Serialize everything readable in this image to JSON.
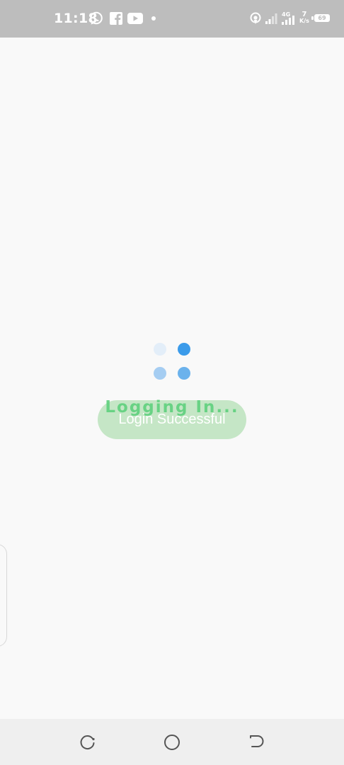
{
  "status_bar": {
    "time": "11:18",
    "notification_icons": [
      "whatsapp-icon",
      "facebook-icon",
      "youtube-icon",
      "more-notifications-dot"
    ],
    "network_label": "4G",
    "speed_value": "7",
    "speed_unit": "K/s",
    "battery_level": "69"
  },
  "loader": {
    "dot_colors": [
      "#e3eef9",
      "#3b9bea",
      "#a5cdf2",
      "#6bb2ec"
    ]
  },
  "loading_text": "Logging In...",
  "toast": {
    "message": "Login Successful"
  },
  "navigation": {
    "buttons": [
      "recent-apps",
      "home",
      "back"
    ]
  },
  "colors": {
    "status_bar_bg": "#bdbdbd",
    "page_bg": "#f9f9f9",
    "toast_bg": "#c5e6c6",
    "loading_text": "#5fd07d",
    "nav_bar_bg": "#efefef"
  }
}
